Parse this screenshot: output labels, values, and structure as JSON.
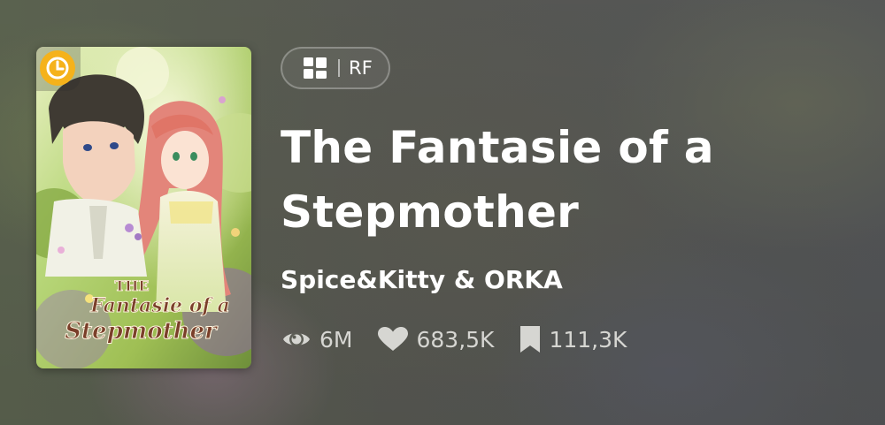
{
  "cover": {
    "title_art_line1": "THE",
    "title_art_line2": "Fantasie of a",
    "title_art_line3": "Stepmother",
    "badge_icon": "clock-icon",
    "badge_color": "#f5b21b"
  },
  "type_chip": {
    "icon": "grid-layout-icon",
    "label": "RF"
  },
  "title": "The Fantasie of a Stepmother",
  "authors": "Spice&Kitty & ORKA",
  "stats": {
    "views": {
      "icon": "eye-icon",
      "value": "6M"
    },
    "likes": {
      "icon": "heart-icon",
      "value": "683,5K"
    },
    "bookmarks": {
      "icon": "bookmark-icon",
      "value": "111,3K"
    }
  },
  "colors": {
    "text_primary": "#ffffff",
    "text_secondary": "#d6d6d2"
  }
}
